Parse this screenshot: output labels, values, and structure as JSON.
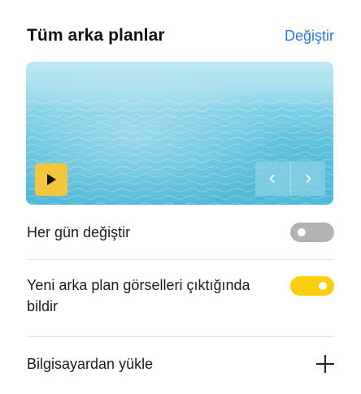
{
  "header": {
    "title": "Tüm arka planlar",
    "change_label": "Değiştir"
  },
  "preview": {
    "image": "ocean-water",
    "play_icon": "play-icon",
    "prev_icon": "chevron-left-icon",
    "next_icon": "chevron-right-icon"
  },
  "settings": {
    "daily_change": {
      "label": "Her gün değiştir",
      "enabled": false
    },
    "notify_new": {
      "label": "Yeni arka plan görselleri çıktığında bildir",
      "enabled": true
    },
    "upload": {
      "label": "Bilgisayardan yükle",
      "icon": "plus-icon"
    }
  },
  "colors": {
    "link": "#2f77d1",
    "toggle_on": "#fdce0c",
    "toggle_off": "#b2b2b2",
    "play_button": "#f3c63d"
  }
}
